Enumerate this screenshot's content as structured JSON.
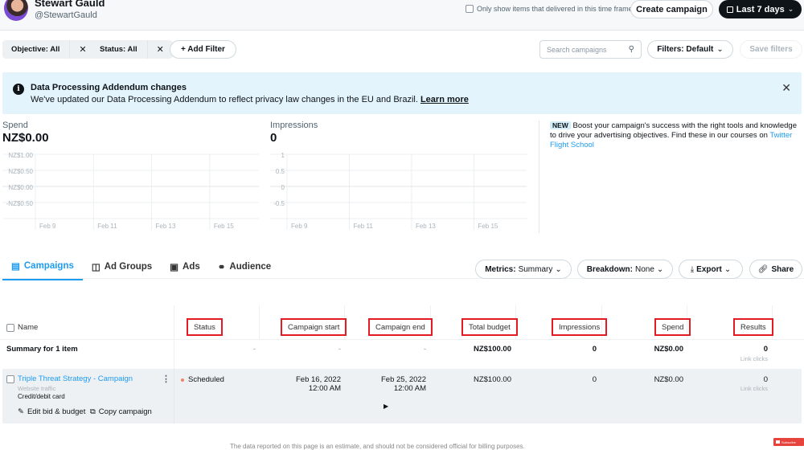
{
  "header": {
    "user_name": "Stewart Gauld",
    "user_handle": "@StewartGauld",
    "delivered_checkbox_label": "Only show items that delivered in this time frame",
    "create_campaign_label": "Create campaign",
    "date_range_label": "Last 7 days"
  },
  "filters": {
    "chips": [
      {
        "label": "Objective: All"
      },
      {
        "label": "Status: All"
      }
    ],
    "add_filter_label": "+ Add Filter",
    "search_placeholder": "Search campaigns",
    "filters_dropdown_label": "Filters: Default",
    "save_filters_label": "Save filters"
  },
  "banner": {
    "title": "Data Processing Addendum changes",
    "text": "We've updated our Data Processing Addendum to reflect privacy law changes in the EU and Brazil.",
    "link_label": "Learn more"
  },
  "metrics": {
    "spend": {
      "label": "Spend",
      "value": "NZ$0.00"
    },
    "impressions": {
      "label": "Impressions",
      "value": "0"
    }
  },
  "chart_data": [
    {
      "type": "line",
      "title": "Spend",
      "x_ticks": [
        "Feb 9",
        "Feb 11",
        "Feb 13",
        "Feb 15"
      ],
      "y_ticks": [
        "NZ$1.00",
        "NZ$0.50",
        "NZ$0.00",
        "-NZ$0.50"
      ],
      "ylim": [
        -0.5,
        1.0
      ],
      "series": [],
      "grid": true
    },
    {
      "type": "line",
      "title": "Impressions",
      "x_ticks": [
        "Feb 9",
        "Feb 11",
        "Feb 13",
        "Feb 15"
      ],
      "y_ticks": [
        "1",
        "0.5",
        "0",
        "-0.5"
      ],
      "ylim": [
        -0.5,
        1.0
      ],
      "series": [],
      "grid": true
    }
  ],
  "promo": {
    "badge": "NEW",
    "text": "Boost your campaign's success with the right tools and knowledge to drive your advertising objectives. Find these in our courses on",
    "link_label": "Twitter Flight School"
  },
  "tabs": [
    {
      "label": "Campaigns",
      "icon": "campaigns-icon",
      "active": true
    },
    {
      "label": "Ad Groups",
      "icon": "ad-groups-icon",
      "active": false
    },
    {
      "label": "Ads",
      "icon": "ads-icon",
      "active": false
    },
    {
      "label": "Audience",
      "icon": "audience-icon",
      "active": false
    }
  ],
  "toolbar": {
    "metrics_key": "Metrics:",
    "metrics_value": "Summary",
    "breakdown_key": "Breakdown:",
    "breakdown_value": "None",
    "export_label": "Export",
    "share_label": "Share"
  },
  "table": {
    "columns": [
      "Name",
      "Status",
      "Campaign start",
      "Campaign end",
      "Total budget",
      "Impressions",
      "Spend",
      "Results"
    ],
    "summary": {
      "name": "Summary for 1 item",
      "status": "-",
      "start": "-",
      "end": "-",
      "budget": "NZ$100.00",
      "impressions": "0",
      "spend": "NZ$0.00",
      "results": "0",
      "results_sub": "Link clicks"
    },
    "rows": [
      {
        "name": "Triple Threat Strategy - Campaign",
        "objective": "Website traffic",
        "payment": "Credit/debit card",
        "edit_label": "Edit bid & budget",
        "copy_label": "Copy campaign",
        "status": "Scheduled",
        "status_color": "#f4845f",
        "start_date": "Feb 16, 2022",
        "start_time": "12:00 AM",
        "end_date": "Feb 25, 2022",
        "end_time": "12:00 AM",
        "budget": "NZ$100.00",
        "impressions": "0",
        "spend": "NZ$0.00",
        "results": "0",
        "results_sub": "Link clicks"
      }
    ]
  },
  "footer": {
    "note": "The data reported on this page is an estimate, and should not be considered official for billing purposes.",
    "yt_label": "Subscribe"
  }
}
